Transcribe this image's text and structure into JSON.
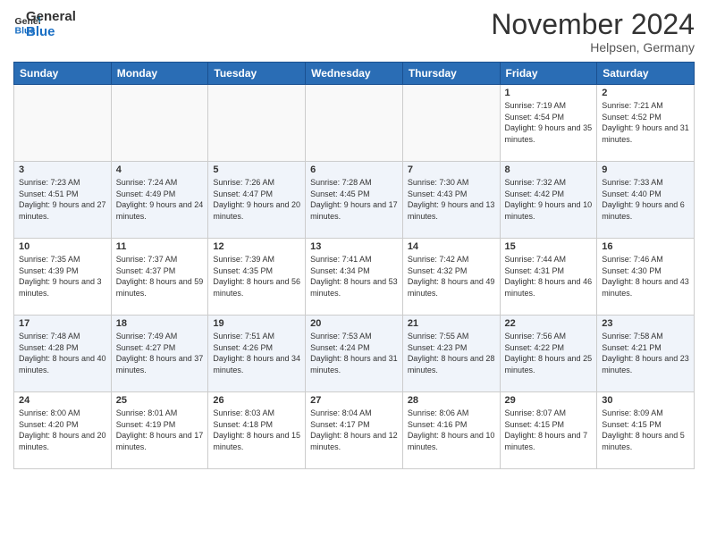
{
  "logo": {
    "line1": "General",
    "line2": "Blue"
  },
  "title": "November 2024",
  "subtitle": "Helpsen, Germany",
  "weekdays": [
    "Sunday",
    "Monday",
    "Tuesday",
    "Wednesday",
    "Thursday",
    "Friday",
    "Saturday"
  ],
  "weeks": [
    [
      {
        "day": "",
        "info": ""
      },
      {
        "day": "",
        "info": ""
      },
      {
        "day": "",
        "info": ""
      },
      {
        "day": "",
        "info": ""
      },
      {
        "day": "",
        "info": ""
      },
      {
        "day": "1",
        "info": "Sunrise: 7:19 AM\nSunset: 4:54 PM\nDaylight: 9 hours and 35 minutes."
      },
      {
        "day": "2",
        "info": "Sunrise: 7:21 AM\nSunset: 4:52 PM\nDaylight: 9 hours and 31 minutes."
      }
    ],
    [
      {
        "day": "3",
        "info": "Sunrise: 7:23 AM\nSunset: 4:51 PM\nDaylight: 9 hours and 27 minutes."
      },
      {
        "day": "4",
        "info": "Sunrise: 7:24 AM\nSunset: 4:49 PM\nDaylight: 9 hours and 24 minutes."
      },
      {
        "day": "5",
        "info": "Sunrise: 7:26 AM\nSunset: 4:47 PM\nDaylight: 9 hours and 20 minutes."
      },
      {
        "day": "6",
        "info": "Sunrise: 7:28 AM\nSunset: 4:45 PM\nDaylight: 9 hours and 17 minutes."
      },
      {
        "day": "7",
        "info": "Sunrise: 7:30 AM\nSunset: 4:43 PM\nDaylight: 9 hours and 13 minutes."
      },
      {
        "day": "8",
        "info": "Sunrise: 7:32 AM\nSunset: 4:42 PM\nDaylight: 9 hours and 10 minutes."
      },
      {
        "day": "9",
        "info": "Sunrise: 7:33 AM\nSunset: 4:40 PM\nDaylight: 9 hours and 6 minutes."
      }
    ],
    [
      {
        "day": "10",
        "info": "Sunrise: 7:35 AM\nSunset: 4:39 PM\nDaylight: 9 hours and 3 minutes."
      },
      {
        "day": "11",
        "info": "Sunrise: 7:37 AM\nSunset: 4:37 PM\nDaylight: 8 hours and 59 minutes."
      },
      {
        "day": "12",
        "info": "Sunrise: 7:39 AM\nSunset: 4:35 PM\nDaylight: 8 hours and 56 minutes."
      },
      {
        "day": "13",
        "info": "Sunrise: 7:41 AM\nSunset: 4:34 PM\nDaylight: 8 hours and 53 minutes."
      },
      {
        "day": "14",
        "info": "Sunrise: 7:42 AM\nSunset: 4:32 PM\nDaylight: 8 hours and 49 minutes."
      },
      {
        "day": "15",
        "info": "Sunrise: 7:44 AM\nSunset: 4:31 PM\nDaylight: 8 hours and 46 minutes."
      },
      {
        "day": "16",
        "info": "Sunrise: 7:46 AM\nSunset: 4:30 PM\nDaylight: 8 hours and 43 minutes."
      }
    ],
    [
      {
        "day": "17",
        "info": "Sunrise: 7:48 AM\nSunset: 4:28 PM\nDaylight: 8 hours and 40 minutes."
      },
      {
        "day": "18",
        "info": "Sunrise: 7:49 AM\nSunset: 4:27 PM\nDaylight: 8 hours and 37 minutes."
      },
      {
        "day": "19",
        "info": "Sunrise: 7:51 AM\nSunset: 4:26 PM\nDaylight: 8 hours and 34 minutes."
      },
      {
        "day": "20",
        "info": "Sunrise: 7:53 AM\nSunset: 4:24 PM\nDaylight: 8 hours and 31 minutes."
      },
      {
        "day": "21",
        "info": "Sunrise: 7:55 AM\nSunset: 4:23 PM\nDaylight: 8 hours and 28 minutes."
      },
      {
        "day": "22",
        "info": "Sunrise: 7:56 AM\nSunset: 4:22 PM\nDaylight: 8 hours and 25 minutes."
      },
      {
        "day": "23",
        "info": "Sunrise: 7:58 AM\nSunset: 4:21 PM\nDaylight: 8 hours and 23 minutes."
      }
    ],
    [
      {
        "day": "24",
        "info": "Sunrise: 8:00 AM\nSunset: 4:20 PM\nDaylight: 8 hours and 20 minutes."
      },
      {
        "day": "25",
        "info": "Sunrise: 8:01 AM\nSunset: 4:19 PM\nDaylight: 8 hours and 17 minutes."
      },
      {
        "day": "26",
        "info": "Sunrise: 8:03 AM\nSunset: 4:18 PM\nDaylight: 8 hours and 15 minutes."
      },
      {
        "day": "27",
        "info": "Sunrise: 8:04 AM\nSunset: 4:17 PM\nDaylight: 8 hours and 12 minutes."
      },
      {
        "day": "28",
        "info": "Sunrise: 8:06 AM\nSunset: 4:16 PM\nDaylight: 8 hours and 10 minutes."
      },
      {
        "day": "29",
        "info": "Sunrise: 8:07 AM\nSunset: 4:15 PM\nDaylight: 8 hours and 7 minutes."
      },
      {
        "day": "30",
        "info": "Sunrise: 8:09 AM\nSunset: 4:15 PM\nDaylight: 8 hours and 5 minutes."
      }
    ]
  ]
}
